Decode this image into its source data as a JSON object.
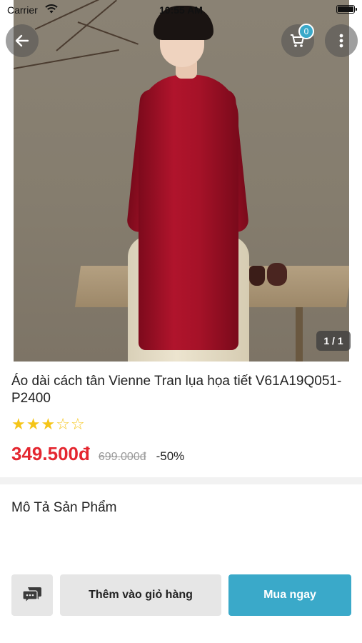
{
  "status_bar": {
    "carrier": "Carrier",
    "time": "10:55 AM",
    "wifi_icon": "wifi-icon",
    "battery_icon": "battery-icon"
  },
  "header": {
    "back_icon": "arrow-left-icon",
    "cart_icon": "cart-icon",
    "cart_count": "0",
    "more_icon": "more-vertical-icon"
  },
  "gallery": {
    "counter": "1 / 1"
  },
  "product": {
    "title": "Áo dài cách tân Vienne Tran lụa họa tiết V61A19Q051-P2400",
    "rating": 3,
    "rating_max": 5,
    "price": "349.500đ",
    "old_price": "699.000đ",
    "discount": "-50%"
  },
  "description": {
    "title": "Mô Tả Sản Phẩm"
  },
  "actions": {
    "chat_icon": "chat-icon",
    "add_to_cart": "Thêm vào giỏ hàng",
    "buy_now": "Mua ngay"
  },
  "colors": {
    "accent": "#3aa9c9",
    "price": "#e4262f",
    "star": "#f5c518"
  }
}
